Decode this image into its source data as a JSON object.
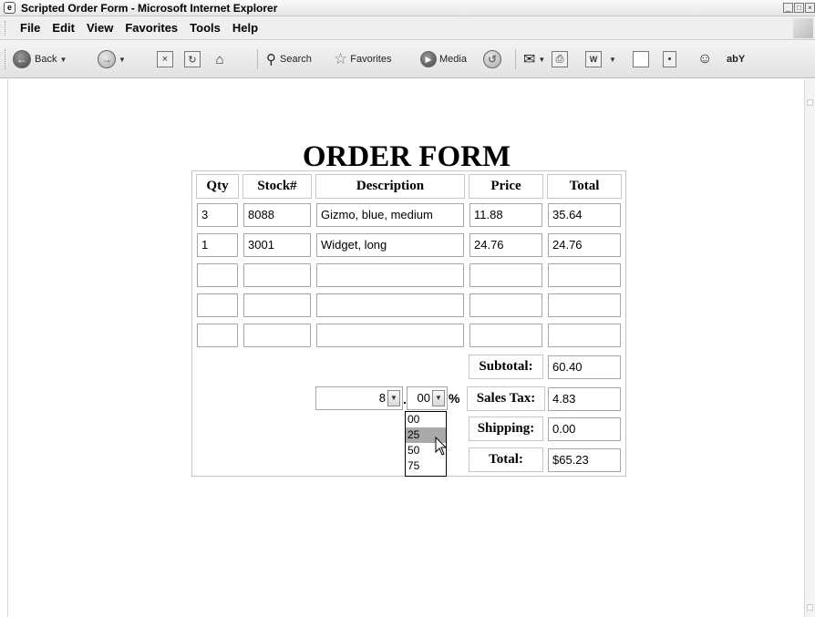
{
  "window": {
    "title": "Scripted Order Form - Microsoft Internet Explorer",
    "icon": "ie-page-icon",
    "controls": [
      "_",
      "□",
      "×"
    ]
  },
  "menu": [
    "File",
    "Edit",
    "View",
    "Favorites",
    "Tools",
    "Help"
  ],
  "toolbar": {
    "back": "Back",
    "search": "Search",
    "favorites": "Favorites",
    "media": "Media"
  },
  "page": {
    "title": "ORDER FORM"
  },
  "form": {
    "headers": [
      "Qty",
      "Stock#",
      "Description",
      "Price",
      "Total"
    ],
    "rows": [
      [
        "3",
        "8088",
        "Gizmo, blue, medium",
        "11.88",
        "35.64"
      ],
      [
        "1",
        "3001",
        "Widget, long",
        "24.76",
        "24.76"
      ],
      [
        "",
        "",
        "",
        "",
        ""
      ],
      [
        "",
        "",
        "",
        "",
        ""
      ],
      [
        "",
        "",
        "",
        "",
        ""
      ]
    ],
    "subtotal_label": "Subtotal:",
    "subtotal": "60.40",
    "tax_whole": "8",
    "tax_dot": ".",
    "tax_frac": "00",
    "tax_percent": "%",
    "sales_tax_label": "Sales Tax:",
    "sales_tax": "4.83",
    "shipping_label": "Shipping:",
    "shipping": "0.00",
    "total_label": "Total:",
    "total": "$65.23",
    "fraction_options": [
      "00",
      "25",
      "50",
      "75"
    ],
    "highlighted_option": "25"
  },
  "colors": {
    "toolbar_bg": "#e9e9e9",
    "highlight": "#a9a9a9"
  }
}
